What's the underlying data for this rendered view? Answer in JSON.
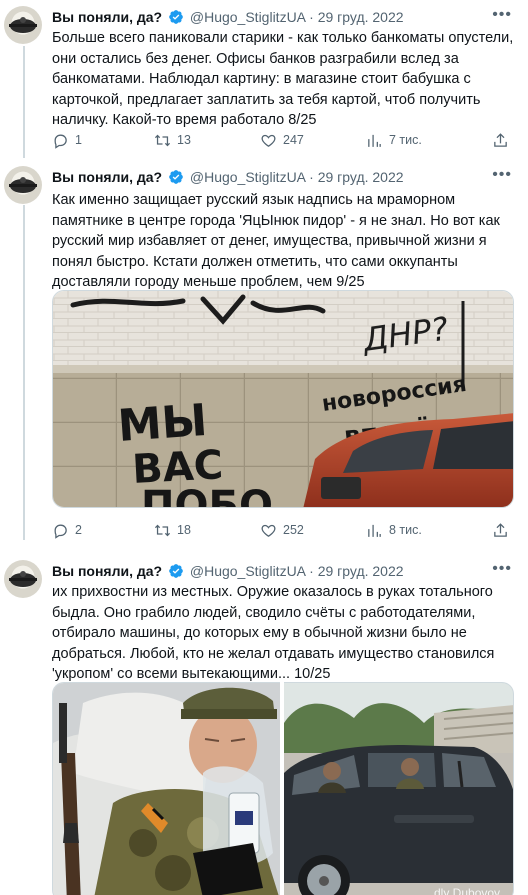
{
  "author": {
    "name": "Вы поняли, да?",
    "handle": "@Hugo_StiglitzUA",
    "date": "· 29 груд. 2022"
  },
  "tweets": [
    {
      "text": "Больше всего паниковали старики - как только банкоматы опустели, они остались без денег. Офисы банков разграбили вслед за банкоматами. Наблюдал картину: в магазине стоит бабушка с карточкой, предлагает заплатить за тебя картой, чтоб получить наличку. Какой-то время работало 8/25",
      "replies": "1",
      "retweets": "13",
      "likes": "247",
      "views": "7 тис."
    },
    {
      "text": "Как именно защищает русский язык надпись на мраморном памятнике в центре города 'ЯцЫнюк пидор' - я не знал. Но вот как русский мир избавляет от денег, имущества, привычной жизни я понял быстро. Кстати должен отметить, что сами оккупанты доставляли городу меньше проблем, чем 9/25",
      "replies": "2",
      "retweets": "18",
      "likes": "252",
      "views": "8 тис.",
      "graffiti": [
        "ДНР?",
        "МЫ",
        "ВАС",
        "ПОБО",
        "новороссия",
        "вперёд"
      ]
    },
    {
      "text": "их прихвостни из местных. Оружие оказалось в руках тотального быдла. Оно грабило людей, сводило счёты с работодателями, отбирало машины, до которых ему в обычной жизни было не добраться. Любой, кто не желал отдавать имущество становился 'укропом' со всеми вытекающими... 10/25",
      "watermark": "dly Dubovoy"
    }
  ],
  "icons": {
    "reply": "reply-icon",
    "retweet": "retweet-icon",
    "like": "like-icon",
    "views": "views-icon",
    "more": "more-icon",
    "verified": "verified-badge-icon"
  },
  "colors": {
    "text": "#0f1419",
    "secondary": "#536471",
    "verified": "#1d9bf0",
    "line": "#cfd9de"
  }
}
